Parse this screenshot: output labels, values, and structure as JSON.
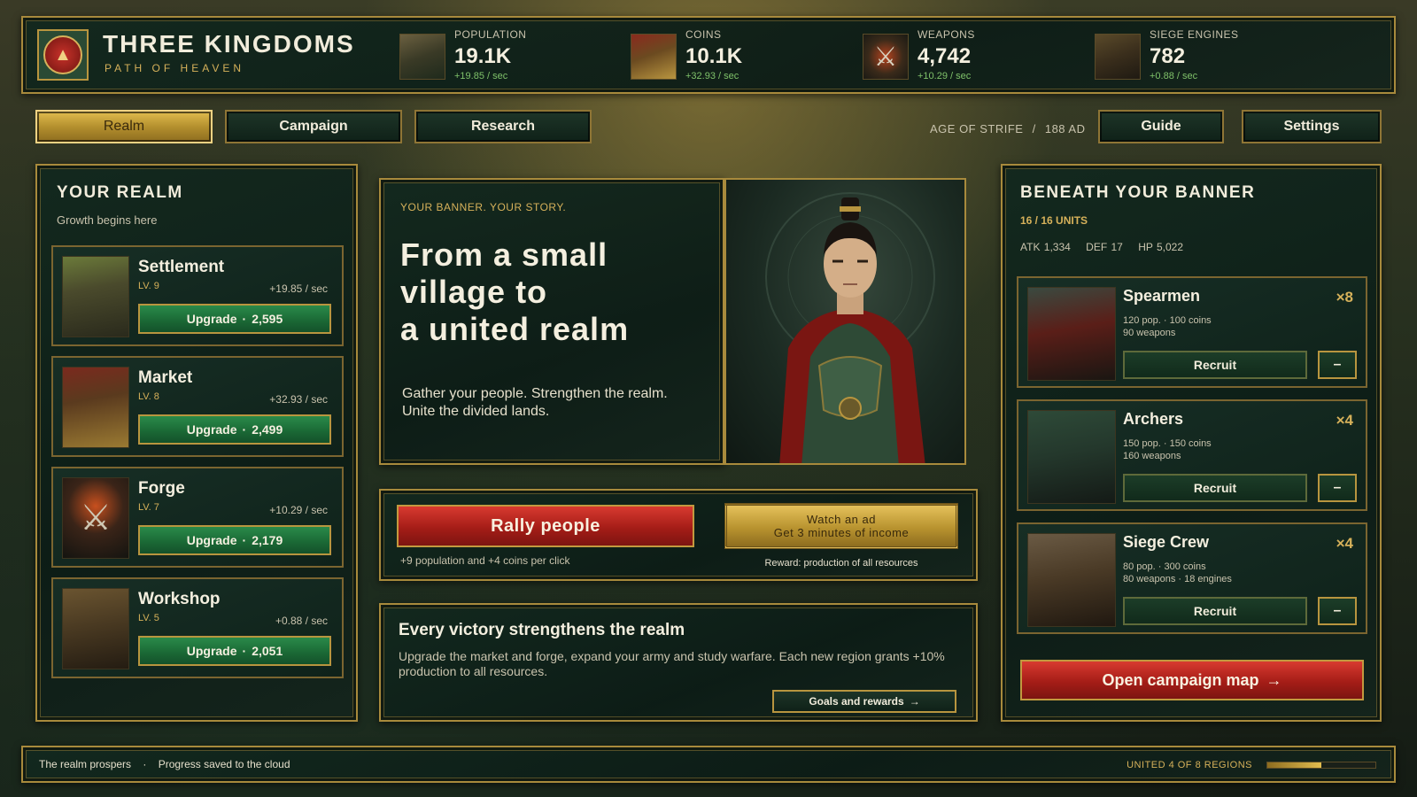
{
  "app": {
    "title": "THREE KINGDOMS",
    "subtitle": "PATH OF HEAVEN",
    "emblem_icon": "red-triangle-emblem-icon"
  },
  "resources": [
    {
      "label": "POPULATION",
      "value": "19.1K",
      "rate": "+19.85 / sec",
      "icon": "village-icon"
    },
    {
      "label": "COINS",
      "value": "10.1K",
      "rate": "+32.93 / sec",
      "icon": "coins-icon"
    },
    {
      "label": "WEAPONS",
      "value": "4,742",
      "rate": "+10.29 / sec",
      "icon": "crossed-swords-icon"
    },
    {
      "label": "SIEGE ENGINES",
      "value": "782",
      "rate": "+0.88 / sec",
      "icon": "catapult-icon"
    }
  ],
  "nav": {
    "tabs": [
      {
        "label": "Realm",
        "active": true
      },
      {
        "label": "Campaign",
        "active": false
      },
      {
        "label": "Research",
        "active": false
      }
    ],
    "era": "AGE OF STRIFE",
    "year": "188 AD",
    "era_separator": "/",
    "guide": "Guide",
    "settings": "Settings"
  },
  "realm": {
    "title": "YOUR REALM",
    "subtitle": "Growth begins here",
    "buildings": [
      {
        "name": "Settlement",
        "level": "LV. 9",
        "rate": "+19.85 / sec",
        "upgrade_label": "Upgrade",
        "separator": "·",
        "cost": "2,595"
      },
      {
        "name": "Market",
        "level": "LV. 8",
        "rate": "+32.93 / sec",
        "upgrade_label": "Upgrade",
        "separator": "·",
        "cost": "2,499"
      },
      {
        "name": "Forge",
        "level": "LV. 7",
        "rate": "+10.29 / sec",
        "upgrade_label": "Upgrade",
        "separator": "·",
        "cost": "2,179"
      },
      {
        "name": "Workshop",
        "level": "LV. 5",
        "rate": "+0.88 / sec",
        "upgrade_label": "Upgrade",
        "separator": "·",
        "cost": "2,051"
      }
    ]
  },
  "story": {
    "kicker": "YOUR BANNER. YOUR STORY.",
    "headline_1": "From a small",
    "headline_2": "village to",
    "headline_3": "a united realm",
    "body_1": "Gather your people. Strengthen the realm.",
    "body_2": "Unite the divided lands."
  },
  "rally": {
    "button": "Rally people",
    "hint": "+9 population and +4 coins per click",
    "ad_line1": "Watch an ad",
    "ad_line2": "Get 3 minutes of income",
    "reward": "Reward: production of all resources"
  },
  "victory": {
    "title": "Every victory strengthens the realm",
    "body": "Upgrade the market and forge, expand your army and study warfare. Each new region grants +10% production to all resources.",
    "goals_button": "Goals and rewards",
    "goals_arrow": "→"
  },
  "army": {
    "title": "BENEATH YOUR BANNER",
    "units_count": "16 / 16 UNITS",
    "atk": "ATK 1,334",
    "def": "DEF 17",
    "hp": "HP 5,022",
    "units": [
      {
        "name": "Spearmen",
        "count": "×8",
        "cost_line1": "120 pop.  ·  100 coins",
        "cost_line2": "90 weapons",
        "recruit": "Recruit",
        "minus": "–"
      },
      {
        "name": "Archers",
        "count": "×4",
        "cost_line1": "150 pop.  ·  150 coins",
        "cost_line2": "160 weapons",
        "recruit": "Recruit",
        "minus": "–"
      },
      {
        "name": "Siege Crew",
        "count": "×4",
        "cost_line1": "80 pop.  ·  300 coins",
        "cost_line2": "80 weapons  ·  18 engines",
        "recruit": "Recruit",
        "minus": "–"
      }
    ],
    "campaign_button": "Open campaign map",
    "campaign_arrow": "→"
  },
  "footer": {
    "status_1": "The realm prospers",
    "separator": "·",
    "status_2": "Progress saved to the cloud",
    "regions": "UNITED 4 OF 8 REGIONS",
    "regions_fraction": 0.5
  },
  "colors": {
    "gold": "#d6b15a",
    "accent_red": "#a51d17",
    "upgrade_green": "#1b6a36",
    "panel_bg": "#12281e"
  }
}
